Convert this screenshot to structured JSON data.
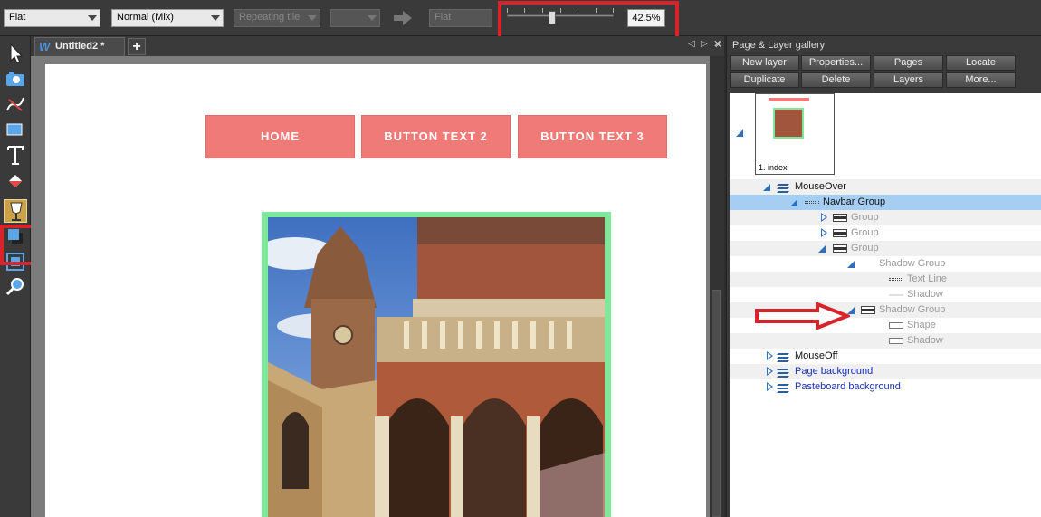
{
  "toolbar": {
    "style_select": "Flat",
    "blend_select": "Normal (Mix)",
    "tile_select": "Repeating tile",
    "profile_select": "Flat",
    "zoom_value": "42.5%"
  },
  "tabs": {
    "document_tab": "Untitled2 *",
    "document_icon": "W",
    "new_tab": "+",
    "prev": "◁",
    "next": "▷",
    "close": "✕"
  },
  "page": {
    "nav_buttons": [
      "HOME",
      "BUTTON TEXT 2",
      "BUTTON TEXT 3"
    ],
    "nav_color": "#f07a78",
    "frame_color": "#7ee99a"
  },
  "gallery": {
    "title": "Page & Layer gallery",
    "close": "✕",
    "buttons_row1": [
      "New layer",
      "Properties...",
      "Pages",
      "Locate"
    ],
    "buttons_row2": [
      "Duplicate",
      "Delete",
      "Layers",
      "More..."
    ],
    "page_thumb_label": "1. index",
    "tree": [
      {
        "label": "MouseOver",
        "style": "normal",
        "icon": "layer-icon",
        "expander": "open"
      },
      {
        "label": "Navbar Group",
        "style": "normal",
        "icon": "group-icon",
        "expander": "open",
        "selected": true
      },
      {
        "label": "Group",
        "style": "grey",
        "icon": "group-icon",
        "expander": "closed"
      },
      {
        "label": "Group",
        "style": "grey",
        "icon": "group-icon",
        "expander": "closed"
      },
      {
        "label": "Group",
        "style": "grey",
        "icon": "group-icon",
        "expander": "open"
      },
      {
        "label": "Shadow Group",
        "style": "grey",
        "icon": "none",
        "expander": "open"
      },
      {
        "label": "Text Line",
        "style": "grey",
        "icon": "text-line-icon",
        "expander": "none"
      },
      {
        "label": "Shadow",
        "style": "grey",
        "icon": "shadow-icon",
        "expander": "none"
      },
      {
        "label": "Shadow Group",
        "style": "grey",
        "icon": "group-icon",
        "expander": "open"
      },
      {
        "label": "Shape",
        "style": "grey",
        "icon": "shape-icon",
        "expander": "none"
      },
      {
        "label": "Shadow",
        "style": "grey",
        "icon": "shape-icon",
        "expander": "none"
      },
      {
        "label": "MouseOff",
        "style": "normal",
        "icon": "layer-icon",
        "expander": "closed"
      },
      {
        "label": "Page background",
        "style": "blue",
        "icon": "layer-icon",
        "expander": "closed"
      },
      {
        "label": "Pasteboard background",
        "style": "blue",
        "icon": "layer-icon",
        "expander": "closed"
      }
    ]
  },
  "highlight_color": "#d9232b"
}
